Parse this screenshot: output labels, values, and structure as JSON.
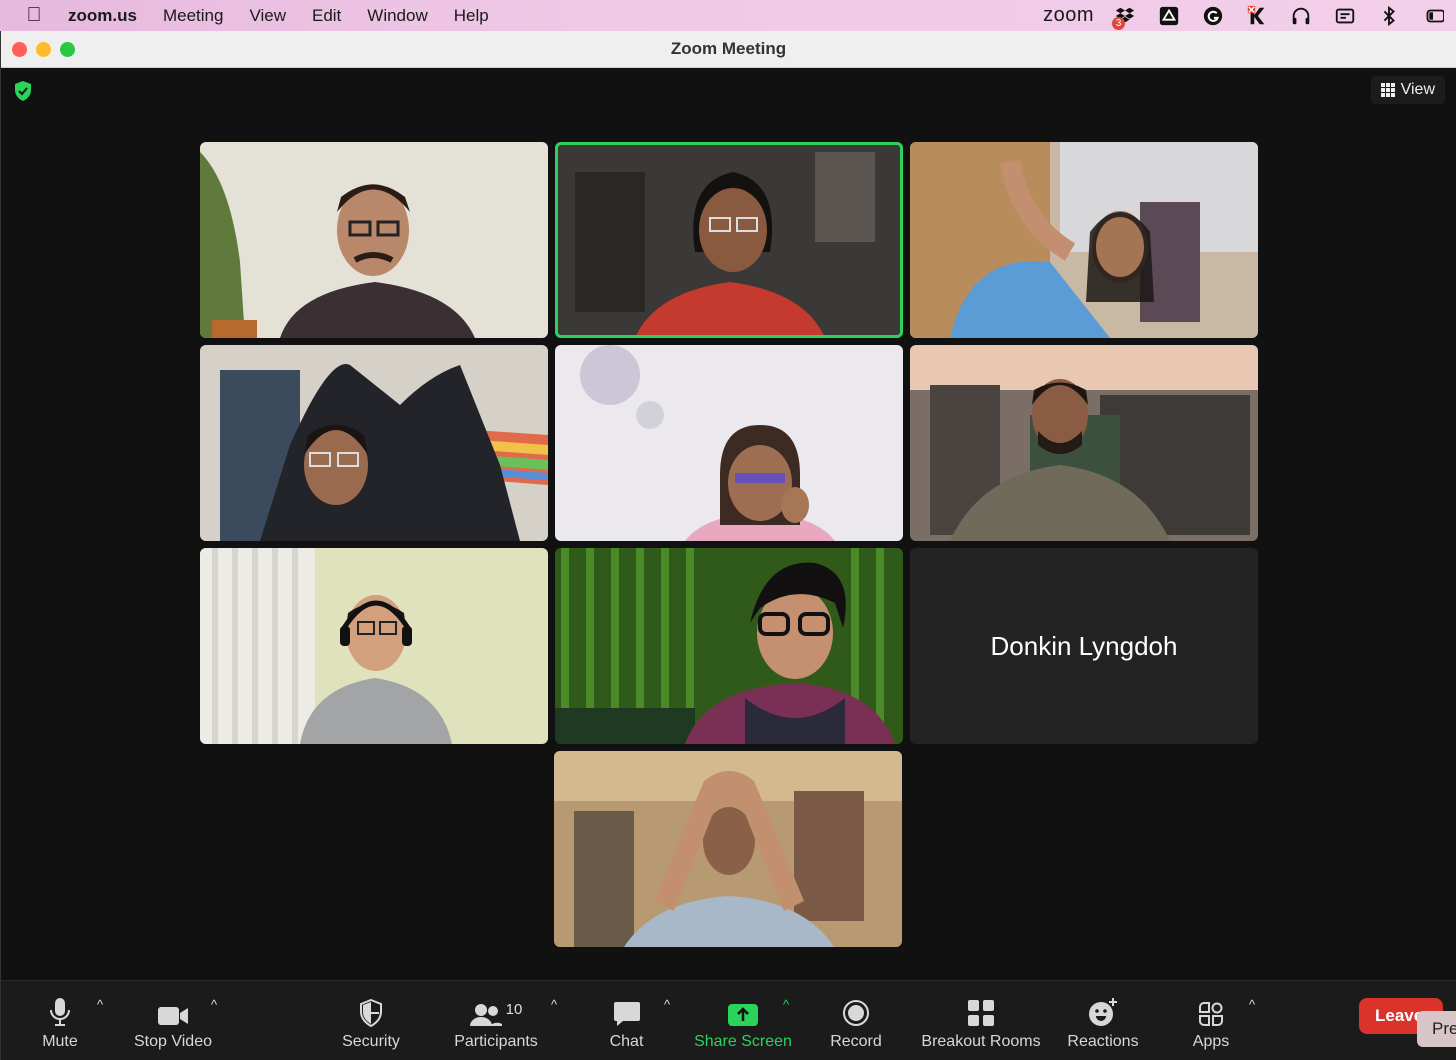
{
  "menubar": {
    "app_name": "zoom.us",
    "items": [
      "Meeting",
      "View",
      "Edit",
      "Window",
      "Help"
    ],
    "tray_zoom_label": "zoom",
    "dropbox_badge": "3"
  },
  "window": {
    "title": "Zoom Meeting"
  },
  "stage": {
    "view_label": "View",
    "no_video_participant": "Donkin Lyngdoh"
  },
  "toolbar": {
    "mute": "Mute",
    "stop_video": "Stop Video",
    "security": "Security",
    "participants": "Participants",
    "participants_count": "10",
    "chat": "Chat",
    "share_screen": "Share Screen",
    "record": "Record",
    "breakout_rooms": "Breakout Rooms",
    "reactions": "Reactions",
    "apps": "Apps",
    "leave": "Leave",
    "pre": "Pre"
  },
  "colors": {
    "accent_green": "#2bd35a",
    "leave_red": "#d9332b",
    "window_bg": "#111111"
  }
}
